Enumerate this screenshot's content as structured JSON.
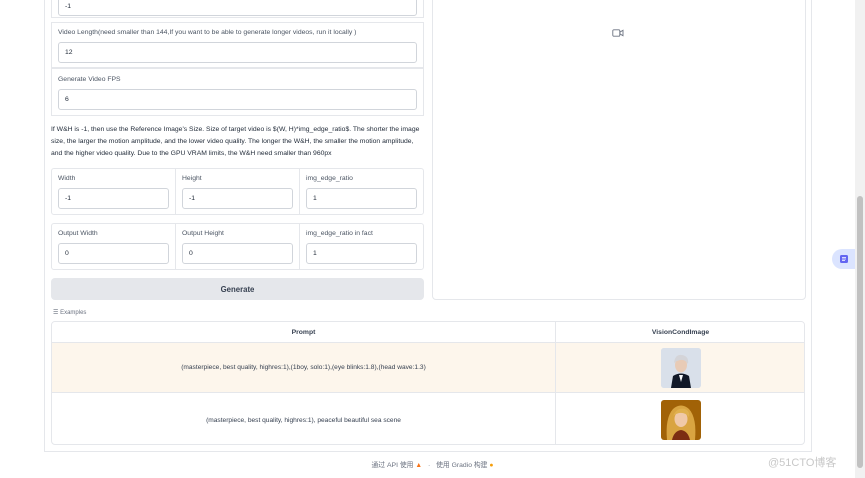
{
  "top_field": {
    "value": "-1"
  },
  "video_length": {
    "label": "Video Length(need smaller than 144,If you want to be able to generate longer videos, run it locally )",
    "value": "12"
  },
  "generate_fps": {
    "label": "Generate Video FPS",
    "value": "6"
  },
  "info_text": "If W&H is -1, then use the Reference Image's Size. Size of target video is $(W, H)*img_edge_ratio$. The shorter the image size, the larger the motion amplitude, and the lower video quality. The longer the W&H, the smaller the motion amplitude, and the higher video quality. Due to the GPU VRAM limits, the W&H need smaller than 960px",
  "size_row": {
    "width": {
      "label": "Width",
      "value": "-1"
    },
    "height": {
      "label": "Height",
      "value": "-1"
    },
    "ratio": {
      "label": "img_edge_ratio",
      "value": "1"
    }
  },
  "output_row": {
    "width": {
      "label": "Output Width",
      "value": "0"
    },
    "height": {
      "label": "Output Height",
      "value": "0"
    },
    "ratio": {
      "label": "img_edge_ratio in fact",
      "value": "1"
    }
  },
  "generate_button": "Generate",
  "examples": {
    "label": "Examples",
    "headers": [
      "Prompt",
      "VisionCondImage"
    ],
    "rows": [
      {
        "prompt": "(masterpiece, best quality, highres:1),(1boy, solo:1),(eye blinks:1.8),(head wave:1.3)"
      },
      {
        "prompt": "(masterpiece, best quality, highres:1), peaceful beautiful sea scene"
      }
    ]
  },
  "footer": {
    "api_text": "通过 API 使用",
    "sep": "·",
    "built_text": "使用 Gradio 构建"
  },
  "watermark": "@51CTO博客",
  "colors": {
    "highlight_row": "#fdf6ec",
    "button_bg": "#e5e7eb",
    "side_button": "#dbe4ff"
  },
  "icons": {
    "video": "video-camera-icon",
    "rocket": "rocket-icon",
    "gradio": "gradio-logo-icon",
    "side": "document-icon"
  }
}
